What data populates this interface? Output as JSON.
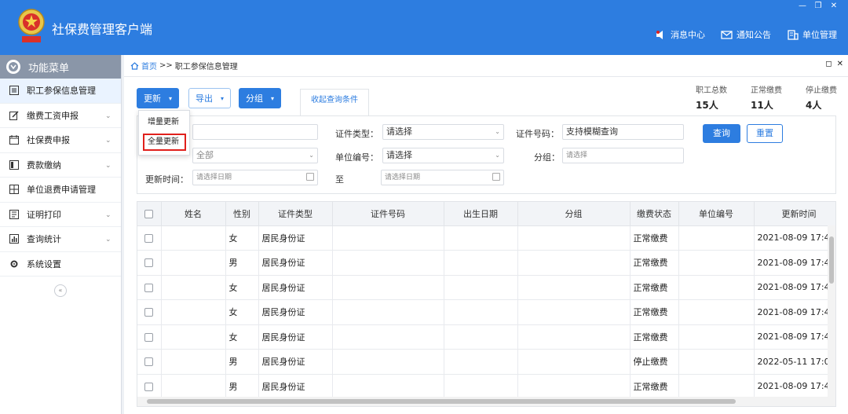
{
  "app": {
    "title": "社保费管理客户端"
  },
  "window": {
    "min": "—",
    "restore": "❐",
    "close": "✕"
  },
  "top_nav": [
    {
      "label": "消息中心"
    },
    {
      "label": "通知公告"
    },
    {
      "label": "单位管理"
    }
  ],
  "sidebar": {
    "header": "功能菜单",
    "items": [
      {
        "label": "职工参保信息管理",
        "expandable": false
      },
      {
        "label": "缴费工资申报",
        "expandable": true
      },
      {
        "label": "社保费申报",
        "expandable": true
      },
      {
        "label": "费款缴纳",
        "expandable": true
      },
      {
        "label": "单位退费申请管理",
        "expandable": false
      },
      {
        "label": "证明打印",
        "expandable": true
      },
      {
        "label": "查询统计",
        "expandable": true
      },
      {
        "label": "系统设置",
        "expandable": false
      }
    ],
    "collapse": "«"
  },
  "breadcrumb": {
    "home": "首页",
    "sep": ">>",
    "current": "职工参保信息管理"
  },
  "toolbar": {
    "update": "更新",
    "export": "导出",
    "group": "分组",
    "collapse_query": "收起查询条件"
  },
  "dropdown": {
    "incremental": "增量更新",
    "full": "全量更新"
  },
  "stats": [
    {
      "label": "职工总数",
      "value": "15人"
    },
    {
      "label": "正常缴费",
      "value": "11人"
    },
    {
      "label": "停止缴费",
      "value": "4人"
    }
  ],
  "filter": {
    "row2_select": "全部",
    "cert_type_label": "证件类型：",
    "cert_type_value": "请选择",
    "cert_no_label": "证件号码：",
    "cert_no_placeholder": "支持模糊查询",
    "unit_no_label": "单位编号：",
    "unit_no_value": "请选择",
    "group_label": "分组：",
    "group_placeholder": "请选择",
    "update_time_label": "更新时间：",
    "date_from_placeholder": "请选择日期",
    "to_label": "至",
    "date_to_placeholder": "请选择日期",
    "query": "查询",
    "reset": "重置"
  },
  "table": {
    "headers": [
      "姓名",
      "性别",
      "证件类型",
      "证件号码",
      "出生日期",
      "分组",
      "缴费状态",
      "单位编号",
      "更新时间"
    ],
    "rows": [
      {
        "gender": "女",
        "cert_type": "居民身份证",
        "status": "正常缴费",
        "updated": "2021-08-09 17:4"
      },
      {
        "gender": "男",
        "cert_type": "居民身份证",
        "status": "正常缴费",
        "updated": "2021-08-09 17:4"
      },
      {
        "gender": "女",
        "cert_type": "居民身份证",
        "status": "正常缴费",
        "updated": "2021-08-09 17:4"
      },
      {
        "gender": "女",
        "cert_type": "居民身份证",
        "status": "正常缴费",
        "updated": "2021-08-09 17:4"
      },
      {
        "gender": "女",
        "cert_type": "居民身份证",
        "status": "正常缴费",
        "updated": "2021-08-09 17:4"
      },
      {
        "gender": "男",
        "cert_type": "居民身份证",
        "status": "停止缴费",
        "updated": "2022-05-11 17:0"
      },
      {
        "gender": "男",
        "cert_type": "居民身份证",
        "status": "正常缴费",
        "updated": "2021-08-09 17:4"
      }
    ]
  },
  "colors": {
    "primary": "#2d7de0",
    "highlight_border": "#e0201c",
    "sidebar_header": "#8a96a8"
  }
}
